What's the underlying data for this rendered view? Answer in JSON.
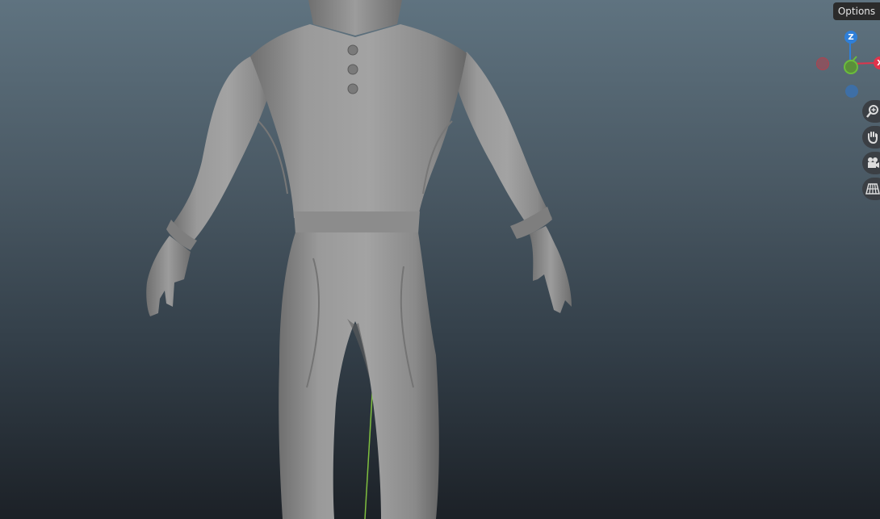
{
  "header": {
    "options_label": "Options"
  },
  "gizmo": {
    "axes": [
      {
        "name": "z",
        "label": "Z",
        "color": "#2f7fd8"
      },
      {
        "name": "x",
        "label": "X",
        "color": "#e0344b"
      },
      {
        "name": "neg-x",
        "label": "",
        "color": "#b0424e"
      },
      {
        "name": "y",
        "label": "",
        "color": "#6bbd3c"
      },
      {
        "name": "neg-z",
        "label": "",
        "color": "#3e6fa6"
      }
    ]
  },
  "navigation": {
    "tools": [
      {
        "name": "zoom",
        "icon": "zoom-in-icon"
      },
      {
        "name": "pan",
        "icon": "hand-icon"
      },
      {
        "name": "camera",
        "icon": "camera-icon"
      },
      {
        "name": "perspective",
        "icon": "grid-icon"
      }
    ]
  },
  "colors": {
    "background_top": "#5f7380",
    "background_bottom": "#1c2127",
    "model": "#8a8a8a",
    "y_axis_line": "#7fbf3f"
  }
}
